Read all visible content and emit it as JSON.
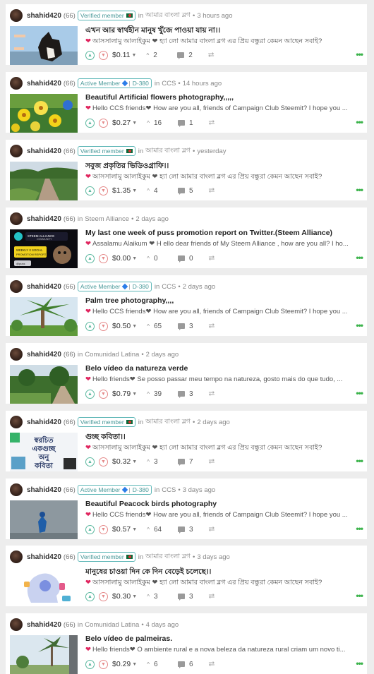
{
  "posts": [
    {
      "author": "shahid420",
      "rep": "(66)",
      "badge": "Verified member",
      "badge_style": "verified",
      "in_label": "in",
      "community": "আমার বাংলা ব্লগ",
      "time": "3 hours ago",
      "title": "এখন আর স্বার্থহীন মানুষ খুঁজে পাওয়া যায় না।।",
      "summary": "আসসালামু আলাইকুম ❤ হ্যা লো আমার বাংলা ব্লগ এর প্রিয় বন্ধুরা কেমন আছেন সবাই?",
      "payout": "$0.11",
      "votes": "2",
      "comments": "2",
      "thumb": "dog"
    },
    {
      "author": "shahid420",
      "rep": "(66)",
      "badge": "Active Member",
      "badge_extra": "D-380",
      "badge_style": "active",
      "in_label": "in",
      "community": "CCS",
      "time": "14 hours ago",
      "title": "Beautiful Artificial flowers photography,,,,,",
      "summary": "Hello CCS friends❤ How are you all, friends of Campaign Club Steemit? I hope you ...",
      "payout": "$0.27",
      "votes": "16",
      "comments": "1",
      "thumb": "flowers"
    },
    {
      "author": "shahid420",
      "rep": "(66)",
      "badge": "Verified member",
      "badge_style": "verified",
      "in_label": "in",
      "community": "আমার বাংলা ব্লগ",
      "time": "yesterday",
      "title": "সবুজ প্রকৃতির ভিডিওগ্রাফি।।",
      "summary": "আসসালামু আলাইকুম ❤ হ্যা লো আমার বাংলা ব্লগ এর প্রিয় বন্ধুরা কেমন আছেন সবাই?",
      "payout": "$1.35",
      "votes": "4",
      "comments": "5",
      "thumb": "path"
    },
    {
      "author": "shahid420",
      "rep": "(66)",
      "badge": "",
      "badge_style": "none",
      "in_label": "in",
      "community": "Steem Alliance",
      "time": "2 days ago",
      "title": "My last one week of puss promotion report on Twitter.(Steem Alliance)",
      "summary": "Assalamu Alaikum ❤ H ello dear friends of My Steem Alliance , how are you all? I ho...",
      "payout": "$0.00",
      "votes": "0",
      "comments": "0",
      "thumb": "alliance",
      "alliance_text": [
        "STEEM ALLIANCE",
        "COMMUNITY",
        "WEEKLY X SOCIAL",
        "PROMOTION REPORT",
        "@puss"
      ]
    },
    {
      "author": "shahid420",
      "rep": "(66)",
      "badge": "Active Member",
      "badge_extra": "D-380",
      "badge_style": "active",
      "in_label": "in",
      "community": "CCS",
      "time": "2 days ago",
      "title": "Palm tree photography,,,,",
      "summary": "Hello CCS friends❤ How are you all, friends of Campaign Club Steemit? I hope you ...",
      "payout": "$0.50",
      "votes": "65",
      "comments": "3",
      "thumb": "palm"
    },
    {
      "author": "shahid420",
      "rep": "(66)",
      "badge": "",
      "badge_style": "none",
      "in_label": "in",
      "community": "Comunidad Latina",
      "time": "2 days ago",
      "title": "Belo vídeo da natureza verde",
      "summary": "Hello friends❤ Se posso passar meu tempo na natureza, gosto mais do que tudo, ...",
      "payout": "$0.79",
      "votes": "39",
      "comments": "3",
      "thumb": "garden"
    },
    {
      "author": "shahid420",
      "rep": "(66)",
      "badge": "Verified member",
      "badge_style": "verified",
      "in_label": "in",
      "community": "আমার বাংলা ব্লগ",
      "time": "2 days ago",
      "title": "গুচ্ছ কবিতা।।",
      "summary": "আসসালামু আলাইকুম ❤ হ্যা লো আমার বাংলা ব্লগ এর প্রিয় বন্ধুরা কেমন আছেন সবাই?",
      "payout": "$0.32",
      "votes": "3",
      "comments": "7",
      "thumb": "poem",
      "poem_text": [
        "স্বরচিত",
        "একগুচ্ছ",
        "অনু",
        "কবিতা"
      ]
    },
    {
      "author": "shahid420",
      "rep": "(66)",
      "badge": "Active Member",
      "badge_extra": "D-380",
      "badge_style": "active",
      "in_label": "in",
      "community": "CCS",
      "time": "3 days ago",
      "title": "Beautiful Peacock birds photography",
      "summary": "Hello CCS friends❤ How are you all, friends of Campaign Club Steemit? I hope you ...",
      "payout": "$0.57",
      "votes": "64",
      "comments": "3",
      "thumb": "peacock"
    },
    {
      "author": "shahid420",
      "rep": "(66)",
      "badge": "Verified member",
      "badge_style": "verified",
      "in_label": "in",
      "community": "আমার বাংলা ব্লগ",
      "time": "3 days ago",
      "title": "মানুষের চাওয়া দিন কে দিন বেড়েই চলেছে।।",
      "summary": "আসসালামু আলাইকুম ❤ হ্যা লো আমার বাংলা ব্লগ এর প্রিয় বন্ধুরা কেমন আছেন সবাই?",
      "payout": "$0.30",
      "votes": "3",
      "comments": "3",
      "thumb": "head"
    },
    {
      "author": "shahid420",
      "rep": "(66)",
      "badge": "",
      "badge_style": "none",
      "in_label": "in",
      "community": "Comunidad Latina",
      "time": "4 days ago",
      "title": "Belo vídeo de palmeiras.",
      "summary": "Hello friends❤ O ambiente rural e a nova beleza da natureza rural criam um novo ti...",
      "payout": "$0.29",
      "votes": "6",
      "comments": "6",
      "thumb": "palms"
    }
  ],
  "icons": {
    "upvote": "chevron-up-icon",
    "downvote": "chevron-down-icon",
    "votes": "caret-up-icon",
    "comments": "comment-icon",
    "reblog": "reblog-icon",
    "more": "more-dots-icon"
  },
  "colors": {
    "upvote": "#5bb89f",
    "downvote": "#e58a8a",
    "badge": "#5eb7b7",
    "more": "#3ab34a",
    "heart": "#e0245e"
  }
}
